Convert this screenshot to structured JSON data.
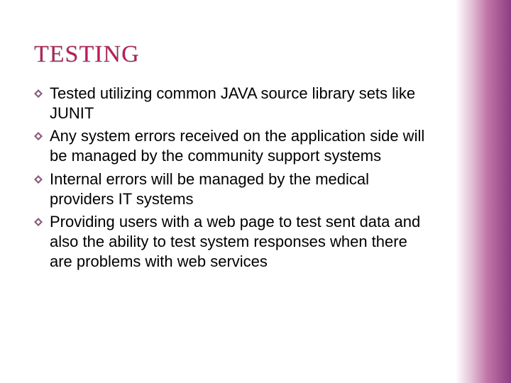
{
  "title": "TESTING",
  "bullets": [
    "Tested utilizing common JAVA source library sets like JUNIT",
    "Any system errors received on the application side will be managed by the community support systems",
    "Internal errors will be managed by the medical providers IT systems",
    "Providing users with a web page to test sent data and also the ability to test system responses when there are problems with web services"
  ]
}
